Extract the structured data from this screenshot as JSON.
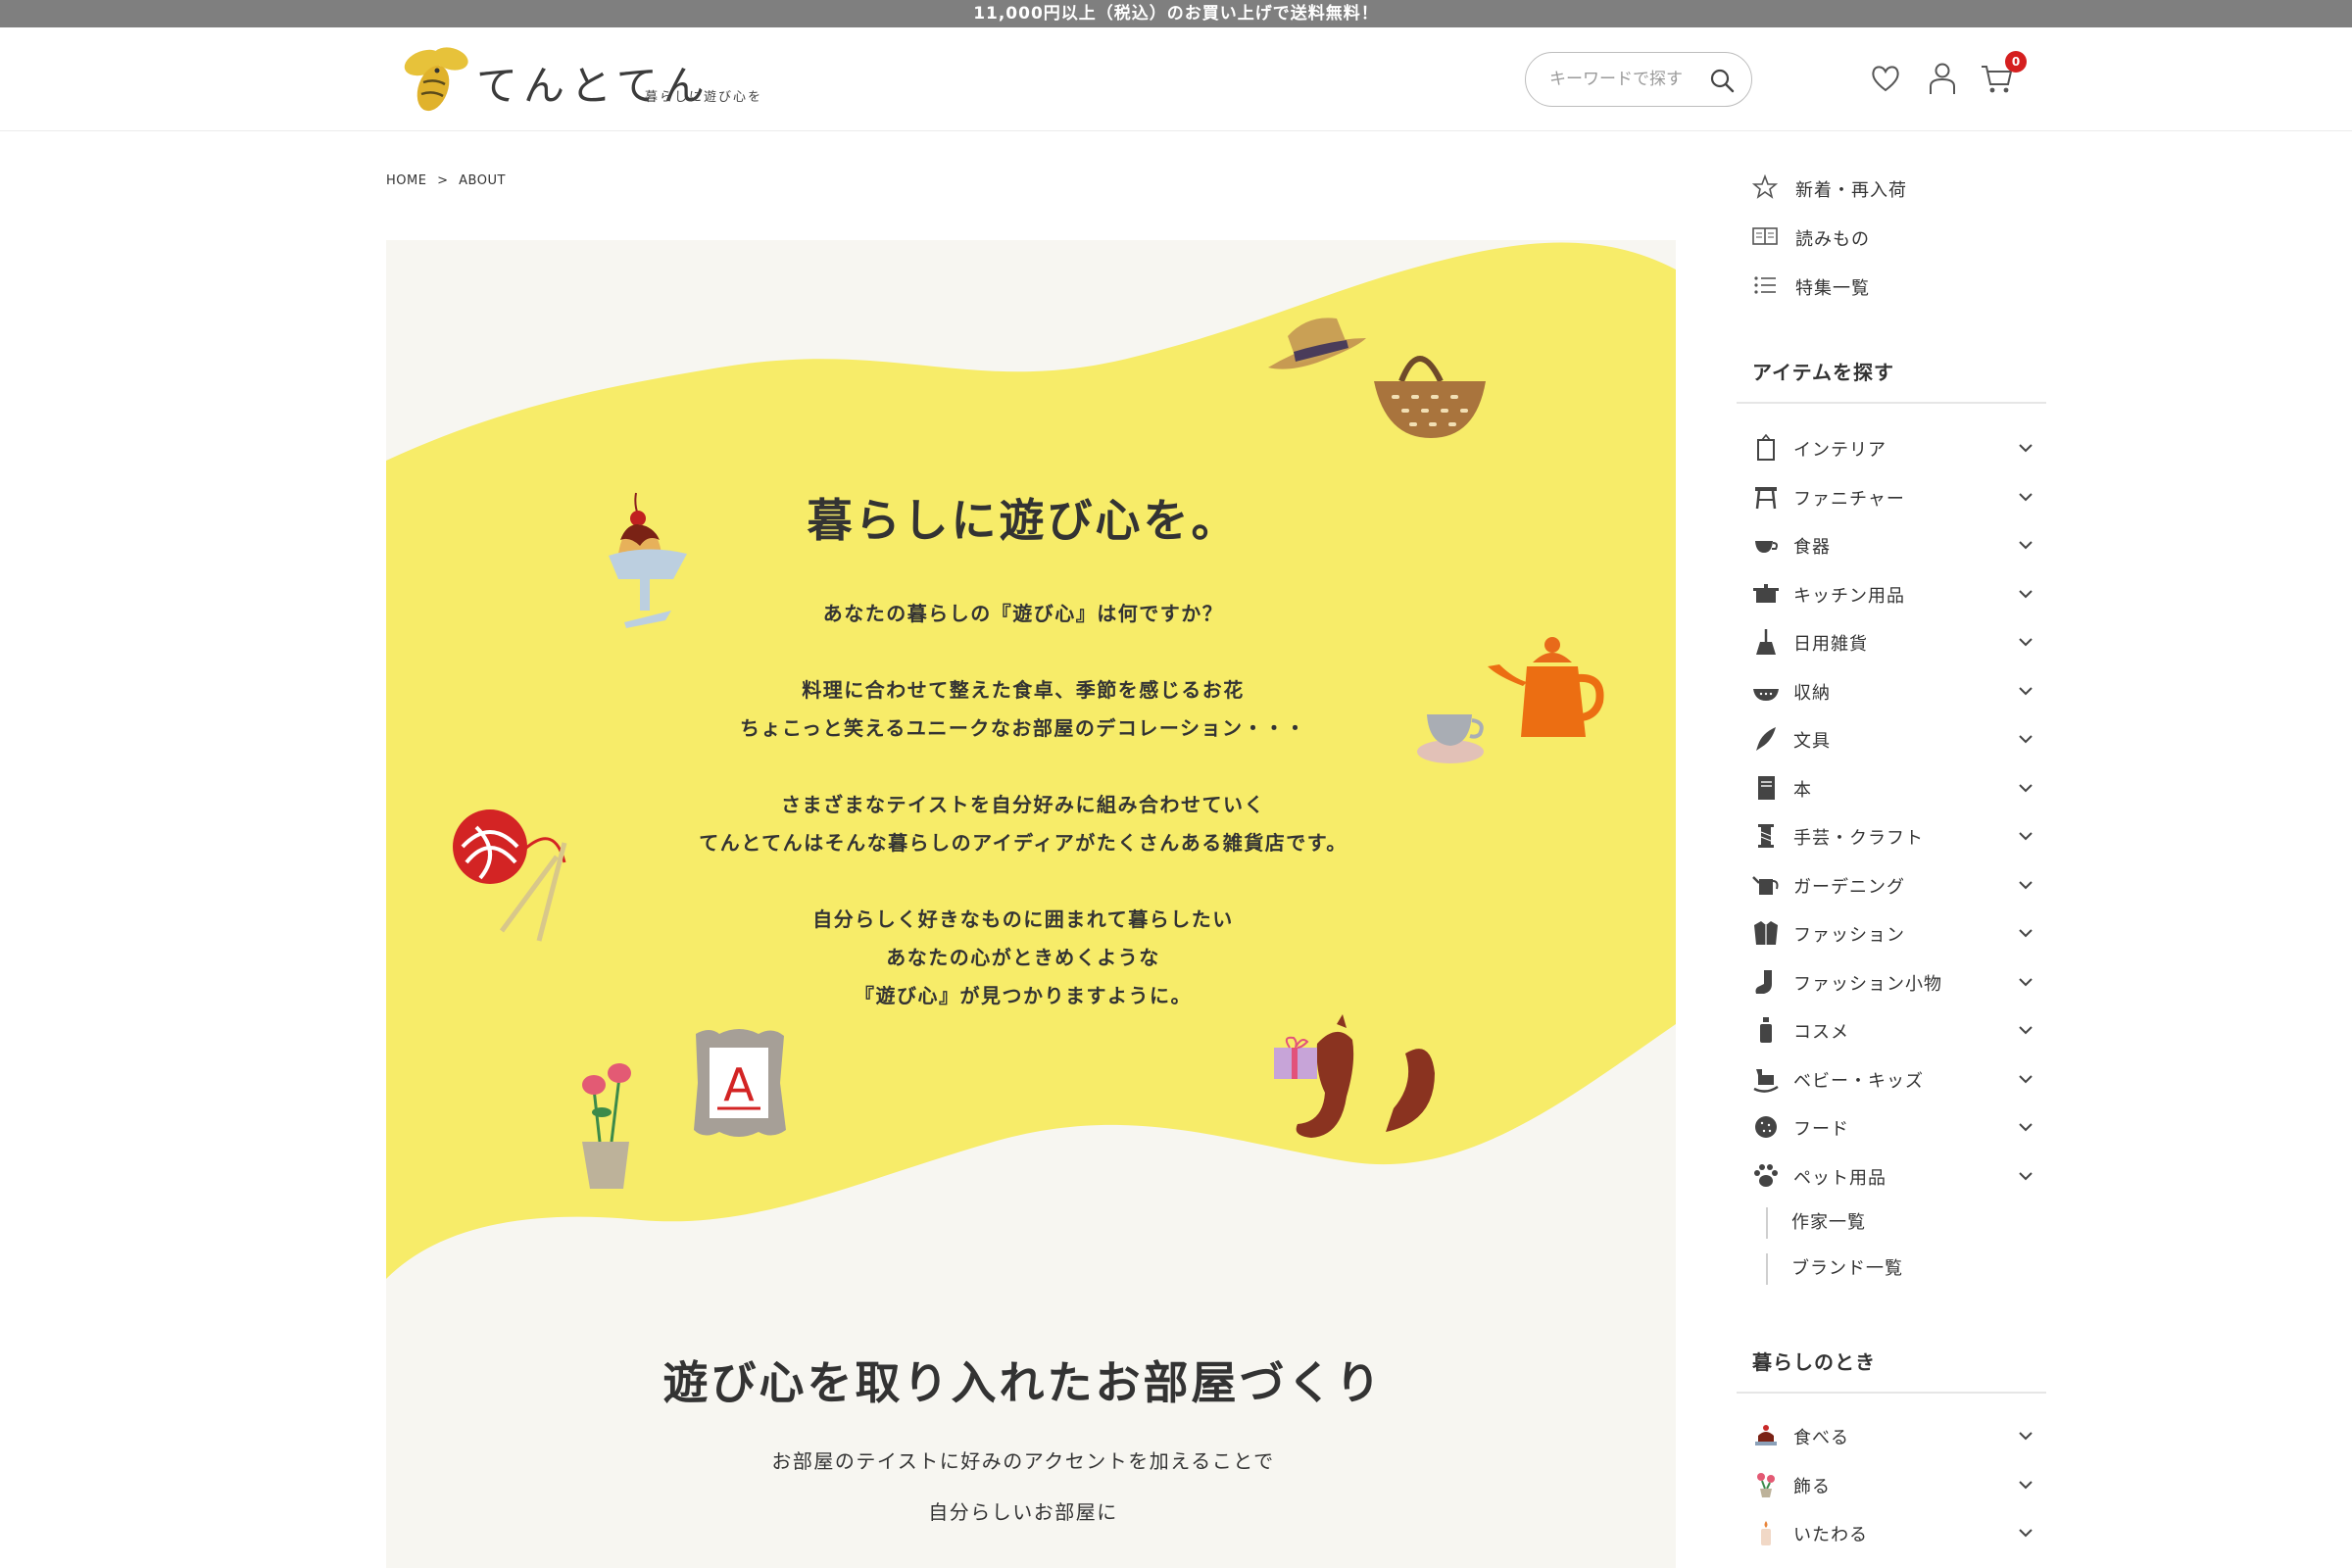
{
  "announcement": "11,000円以上（税込）のお買い上げで送料無料！",
  "logo": {
    "text": "てんとてん",
    "tagline": "暮らしに遊び心を"
  },
  "search": {
    "placeholder": "キーワードで探す"
  },
  "cart": {
    "count": "0"
  },
  "breadcrumb": {
    "home": "HOME",
    "sep": ">",
    "current": "ABOUT"
  },
  "hero": {
    "title": "暮らしに遊び心を。",
    "lines": [
      "あなたの暮らしの『遊び心』は何ですか？",
      "",
      "料理に合わせて整えた食卓、季節を感じるお花",
      "ちょこっと笑えるユニークなお部屋のデコレーション・・・",
      "",
      "さまざまなテイストを自分好みに組み合わせていく",
      "てんとてんはそんな暮らしのアイディアがたくさんある雑貨店です。",
      "",
      "自分らしく好きなものに囲まれて暮らしたい",
      "あなたの心がときめくような",
      "『遊び心』が見つかりますように。"
    ]
  },
  "section2": {
    "title": "遊び心を取り入れたお部屋づくり",
    "line1": "お部屋のテイストに好みのアクセントを加えることで",
    "line2": "自分らしいお部屋に"
  },
  "sidebar": {
    "links": [
      {
        "label": "新着・再入荷",
        "icon": "star-icon"
      },
      {
        "label": "読みもの",
        "icon": "book-icon"
      },
      {
        "label": "特集一覧",
        "icon": "list-icon"
      }
    ],
    "items_heading": "アイテムを探す",
    "categories": [
      {
        "label": "インテリア",
        "icon": "interior-icon"
      },
      {
        "label": "ファニチャー",
        "icon": "furniture-icon"
      },
      {
        "label": "食器",
        "icon": "tableware-icon"
      },
      {
        "label": "キッチン用品",
        "icon": "kitchen-icon"
      },
      {
        "label": "日用雑貨",
        "icon": "broom-icon"
      },
      {
        "label": "収納",
        "icon": "storage-icon"
      },
      {
        "label": "文具",
        "icon": "pen-icon"
      },
      {
        "label": "本",
        "icon": "book-icon"
      },
      {
        "label": "手芸・クラフト",
        "icon": "craft-icon"
      },
      {
        "label": "ガーデニング",
        "icon": "watering-can-icon"
      },
      {
        "label": "ファッション",
        "icon": "jacket-icon"
      },
      {
        "label": "ファッション小物",
        "icon": "sock-icon"
      },
      {
        "label": "コスメ",
        "icon": "bottle-icon"
      },
      {
        "label": "ベビー・キッズ",
        "icon": "rocking-horse-icon"
      },
      {
        "label": "フード",
        "icon": "cookie-icon"
      },
      {
        "label": "ペット用品",
        "icon": "paw-icon"
      }
    ],
    "sublinks": [
      "作家一覧",
      "ブランド一覧"
    ],
    "life_heading": "暮らしのとき",
    "life": [
      {
        "label": "食べる",
        "icon": "eat-icon"
      },
      {
        "label": "飾る",
        "icon": "decorate-icon"
      },
      {
        "label": "いたわる",
        "icon": "care-icon"
      }
    ]
  },
  "colors": {
    "hero_yellow": "#f7ec69",
    "section_bg": "#f7f6f1",
    "announcement_bg": "#7f7f7f",
    "badge": "#d51f1f"
  }
}
